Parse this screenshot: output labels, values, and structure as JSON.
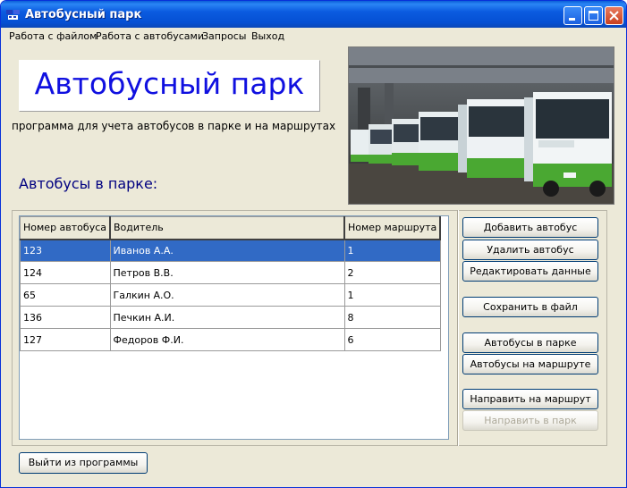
{
  "window": {
    "title": "Автобусный парк",
    "icon": "bus-app-icon",
    "controls": [
      "minimize-icon",
      "maximize-icon",
      "close-icon"
    ]
  },
  "menu": [
    {
      "label": "Работа с файлом"
    },
    {
      "label": "Работа с автобусами"
    },
    {
      "label": "Запросы"
    },
    {
      "label": "Выход"
    }
  ],
  "banner": {
    "title": "Автобусный парк",
    "subtitle": "программа для учета автобусов в парке и на  маршрутах"
  },
  "section": {
    "heading": "Автобусы в парке:"
  },
  "photo": {
    "subject": "buses in depot photo"
  },
  "grid": {
    "columns": [
      "Номер автобуса",
      "Водитель",
      "Номер маршрута"
    ],
    "selected_row": 0,
    "rows": [
      [
        "123",
        "Иванов А.А.",
        "1"
      ],
      [
        "124",
        "Петров В.В.",
        "2"
      ],
      [
        "65",
        "Галкин А.О.",
        "1"
      ],
      [
        "136",
        "Печкин А.И.",
        "8"
      ],
      [
        "127",
        "Федоров Ф.И.",
        "6"
      ]
    ]
  },
  "buttons": {
    "add": "Добавить автобус",
    "remove": "Удалить автобус",
    "edit": "Редактировать данные",
    "save": "Сохранить в файл",
    "in_park": "Автобусы в парке",
    "on_route": "Автобусы на маршруте",
    "send_route": "Направить на маршрут",
    "send_park": "Направить в парк",
    "exit": "Выйти из программы"
  },
  "colors": {
    "titlebar": "#0a5fd8",
    "banner_text": "#1010e0",
    "heading_text": "#000080",
    "selection": "#316ac5",
    "bus_livery": "#4aa832"
  }
}
